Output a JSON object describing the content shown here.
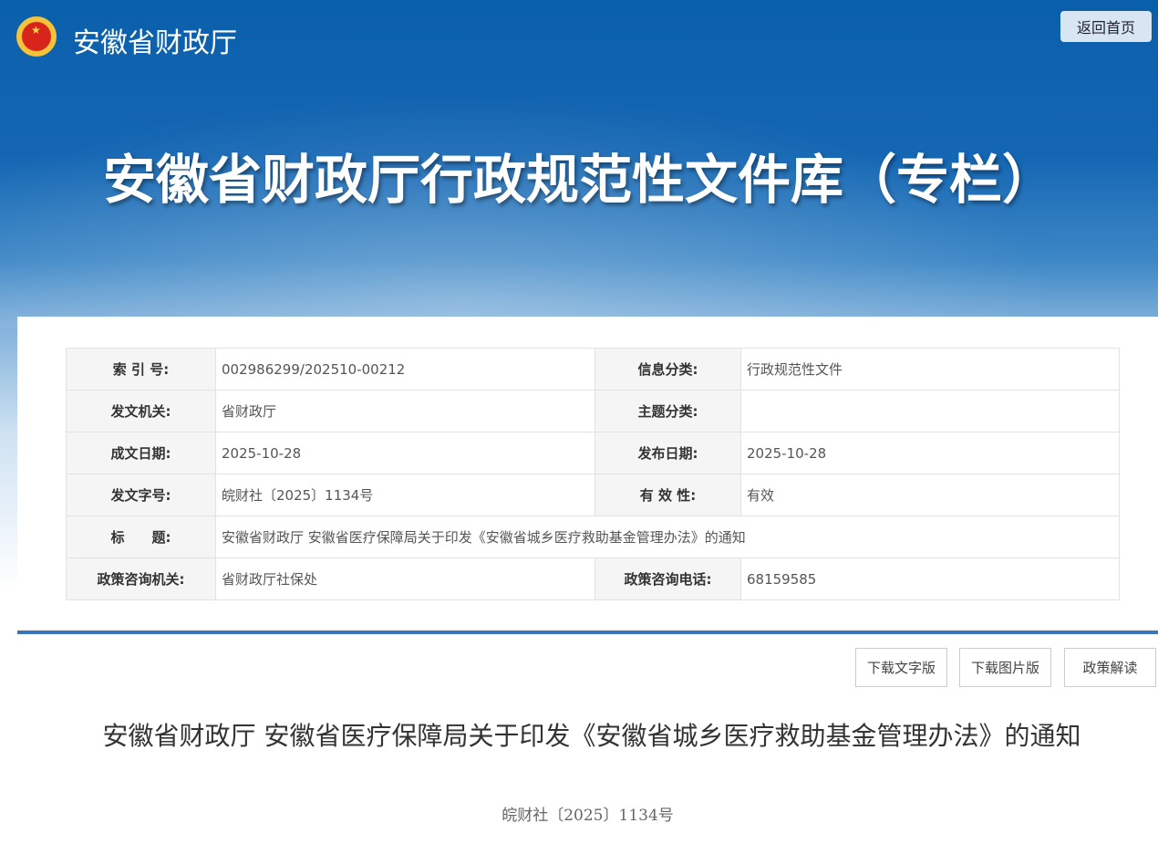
{
  "header": {
    "site_name": "安徽省财政厅",
    "home_button": "返回首页",
    "banner_title": "安徽省财政厅行政规范性文件库（专栏）"
  },
  "meta": [
    [
      {
        "label": "索 引 号:",
        "value": "002986299/202510-00212"
      },
      {
        "label": "信息分类:",
        "value": "行政规范性文件"
      }
    ],
    [
      {
        "label": "发文机关:",
        "value": "省财政厅"
      },
      {
        "label": "主题分类:",
        "value": ""
      }
    ],
    [
      {
        "label": "成文日期:",
        "value": "2025-10-28"
      },
      {
        "label": "发布日期:",
        "value": "2025-10-28"
      }
    ],
    [
      {
        "label": "发文字号:",
        "value": "皖财社〔2025〕1134号"
      },
      {
        "label": "有 效 性:",
        "value": "有效"
      }
    ]
  ],
  "title_row": {
    "label": "标　　题:",
    "value": "安徽省财政厅 安徽省医疗保障局关于印发《安徽省城乡医疗救助基金管理办法》的通知"
  },
  "contact": [
    {
      "label": "政策咨询机关:",
      "value": "省财政厅社保处"
    },
    {
      "label": "政策咨询电话:",
      "value": "68159585"
    }
  ],
  "actions": {
    "download_text": "下载文字版",
    "download_image": "下载图片版",
    "interpretation": "政策解读"
  },
  "document": {
    "title": "安徽省财政厅  安徽省医疗保障局关于印发《安徽省城乡医疗救助基金管理办法》的通知",
    "number": "皖财社〔2025〕1134号"
  }
}
